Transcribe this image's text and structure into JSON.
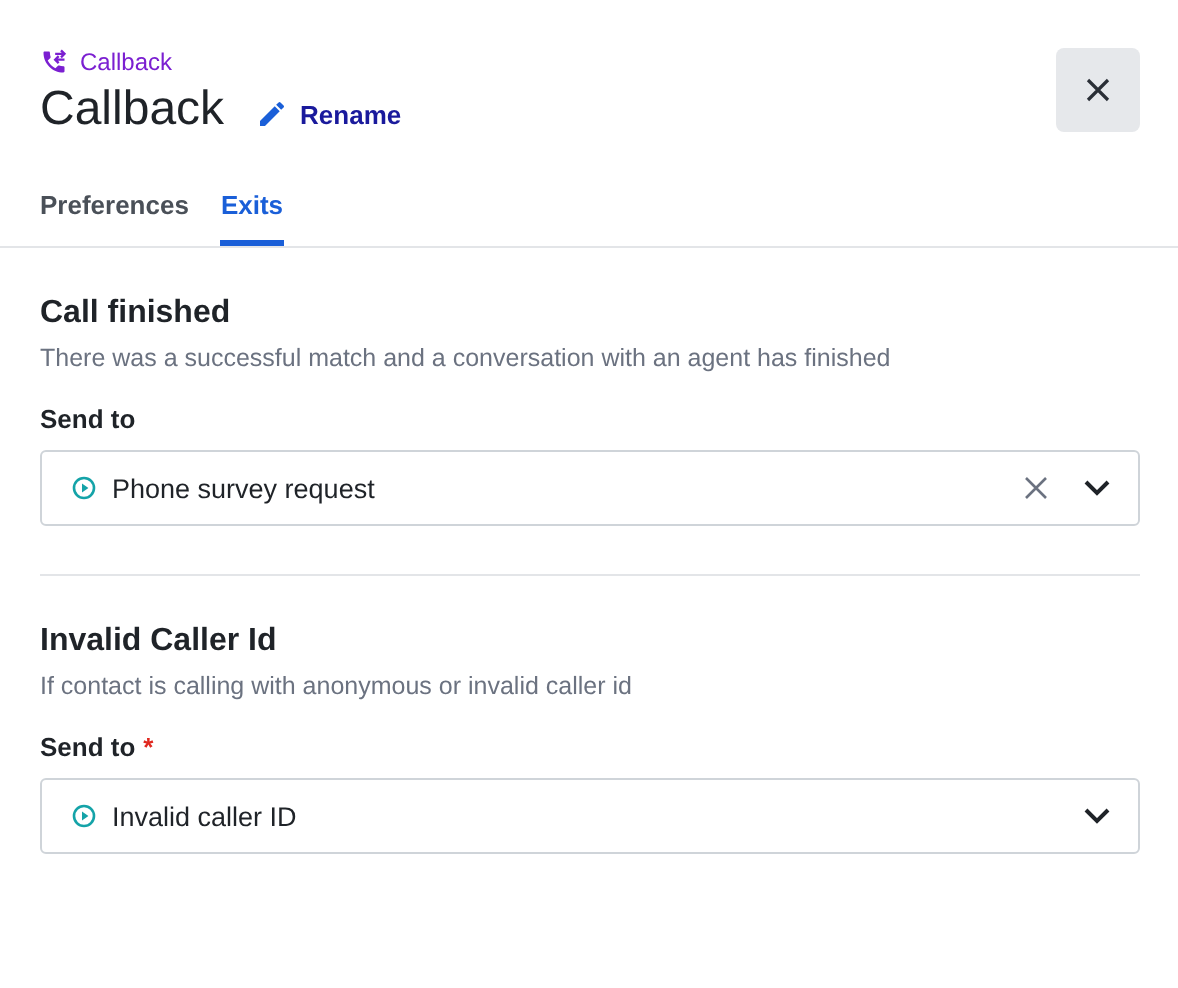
{
  "header": {
    "type_label": "Callback",
    "title": "Callback",
    "rename": "Rename"
  },
  "tabs": [
    {
      "label": "Preferences",
      "selected": false
    },
    {
      "label": "Exits",
      "selected": true
    }
  ],
  "exits": [
    {
      "title": "Call finished",
      "description": "There was a successful match and a conversation with an agent has finished",
      "field_label": "Send to",
      "value": "Phone survey request",
      "clearable": true
    },
    {
      "title": "Invalid Caller Id",
      "description": "If contact is calling with anonymous or invalid caller id",
      "field_label": "Send to",
      "required_mark": "*",
      "value": "Invalid caller ID",
      "clearable": false
    }
  ]
}
